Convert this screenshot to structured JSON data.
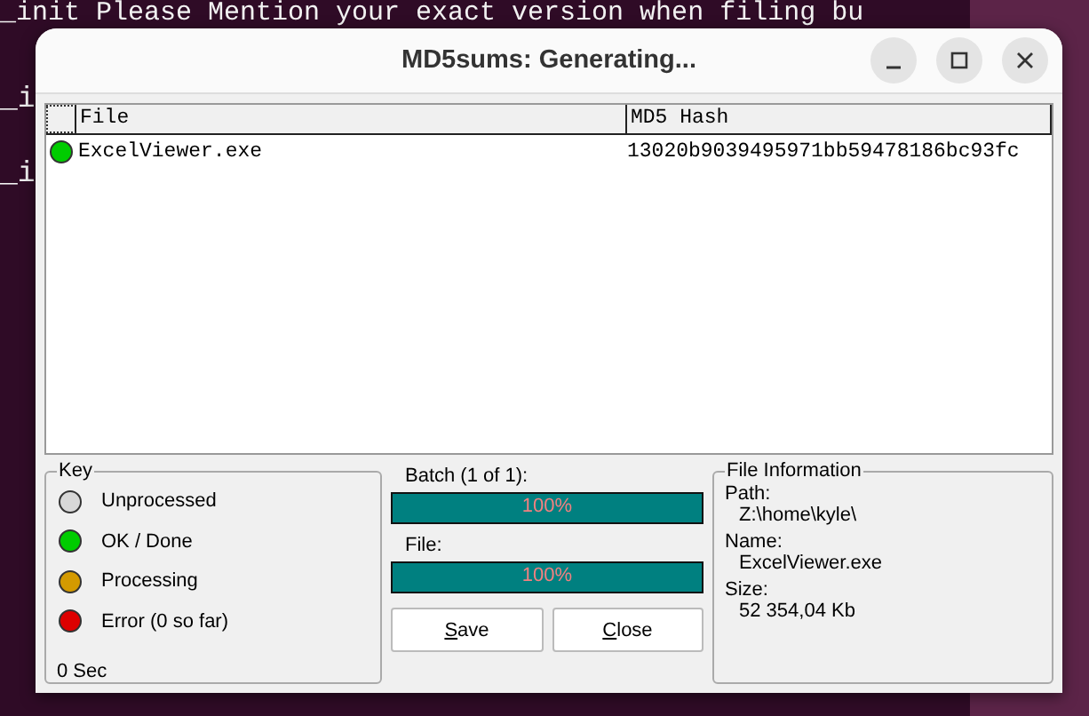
{
  "terminal": {
    "lines": [
      "_init Please Mention your exact version when filing bu",
      "_i",
      "_i"
    ]
  },
  "window": {
    "title": "MD5sums: Generating..."
  },
  "table": {
    "columns": [
      "File",
      "MD5 Hash"
    ],
    "rows": [
      {
        "color": "#00cc00",
        "file": "ExcelViewer.exe",
        "hash": "13020b9039495971bb59478186bc93fc"
      }
    ]
  },
  "key": {
    "title": "Key",
    "items": [
      {
        "color": "#d8d8d8",
        "label": "Unprocessed"
      },
      {
        "color": "#00cc00",
        "label": "OK / Done"
      },
      {
        "color": "#d49a00",
        "label": "Processing"
      },
      {
        "color": "#dd0000",
        "label": "Error (0 so far)"
      }
    ],
    "elapsed": "0 Sec"
  },
  "progress": [
    {
      "label": "Batch (1 of 1):",
      "level": 1,
      "reading": "100%"
    },
    {
      "label": "File:",
      "level": 1,
      "reading": "100%"
    }
  ],
  "buttons": [
    {
      "label": "Save"
    },
    {
      "label": "Close"
    }
  ],
  "file_info": {
    "title": "File Information",
    "fields": [
      {
        "label": "Path:",
        "value": "Z:\\home\\kyle\\"
      },
      {
        "label": "Name:",
        "value": "ExcelViewer.exe"
      },
      {
        "label": "Size:",
        "value": "52 354,04 Kb"
      }
    ]
  }
}
